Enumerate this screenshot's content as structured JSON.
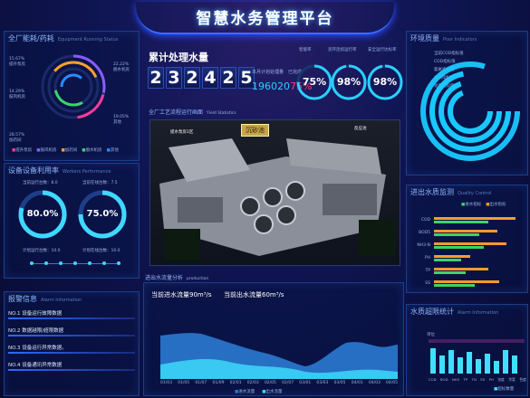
{
  "title": "智慧水务管理平台",
  "equip": {
    "title": "全厂能耗/药耗",
    "sub": "Equipment Running Status",
    "labels": [
      {
        "pct": "15.67%",
        "name": "提升泵房"
      },
      {
        "pct": "14.29%",
        "name": "鼓风机房"
      },
      {
        "pct": "28.57%",
        "name": "加药间"
      },
      {
        "pct": "22.22%",
        "name": "脱水机房"
      },
      {
        "pct": "19.05%",
        "name": "其他"
      }
    ],
    "legend": [
      "提升泵房",
      "鼓风机房",
      "加药间",
      "脱水机房",
      "其他"
    ]
  },
  "workers": {
    "title": "设备设备利用率",
    "sub": "Workers Performance",
    "g1": {
      "top": "当前运行台数：8.0",
      "value": "80.0%",
      "bottom": "计划运行台数：10.0"
    },
    "g2": {
      "top": "当前在线台数：7.5",
      "value": "75.0%",
      "bottom": "计划在线台数：10.0"
    }
  },
  "alarm": {
    "title": "报警信息",
    "sub": "Alarm Information",
    "rows": [
      "NO.1  设备运行故障数据",
      "NO.2  数据越限/超限数据",
      "NO.3  设备运行异常数据。",
      "NO.4  设备通讯异常数据"
    ]
  },
  "water": {
    "title": "累计处理水量",
    "digits": [
      "2",
      "3",
      "2",
      "4",
      "2",
      "5"
    ],
    "plan_label": "本月计划处理量",
    "done_label": "已完成",
    "plan_value": "196020",
    "done_value": "75%"
  },
  "rates": [
    {
      "label": "智能率",
      "value": "75%"
    },
    {
      "label": "泥环连续运行率",
      "value": "98%"
    },
    {
      "label": "安全运行达标率",
      "value": "98%"
    }
  ],
  "scene": {
    "title": "全厂工艺流程运行画面",
    "sub": "Yield Statistics",
    "tag": "沉砂池",
    "label1": "提水泵房1区",
    "label2": "反应池"
  },
  "flow": {
    "title": "进出水流量分析",
    "sub": "production",
    "inflow": "当前进水流量90m³/s",
    "outflow": "当前出水流量60m³/s",
    "legend": [
      "进水流量",
      "出水流量"
    ],
    "x": [
      "01/03",
      "01/05",
      "01/07",
      "01/09",
      "02/01",
      "02/03",
      "02/05",
      "02/07",
      "03/01",
      "03/03",
      "03/05",
      "04/01",
      "04/03",
      "04/05"
    ],
    "yticks": [
      "100",
      "80",
      "60",
      "40",
      "20",
      "0"
    ]
  },
  "env": {
    "title": "环境质量",
    "sub": "Poor Indicators",
    "legend": [
      "当前COD指标值",
      "COD指标值",
      "氨氮指标值",
      "总磷指标值",
      "总氮指标值"
    ]
  },
  "quality": {
    "title": "进出水质监测",
    "sub": "Quality Control",
    "legend": [
      "进水指标",
      "出水指标"
    ],
    "rows": [
      "COD",
      "BOD5",
      "NH3-N",
      "PH",
      "TP",
      "SS"
    ]
  },
  "alarmstats": {
    "title": "水质超限统计",
    "sub": "Alarm Information",
    "legend": "超标数量",
    "x": [
      "COD",
      "BOD",
      "NH3",
      "TP",
      "TN",
      "SS",
      "PH",
      "浊度",
      "余氯",
      "色度",
      "细菌"
    ],
    "yaxis": "单位"
  },
  "colors": {
    "accent": "#3b6dff",
    "cyan": "#15e0ff",
    "red": "#ff3b6b",
    "green": "#3bd46a",
    "orange": "#ff9a2a"
  }
}
